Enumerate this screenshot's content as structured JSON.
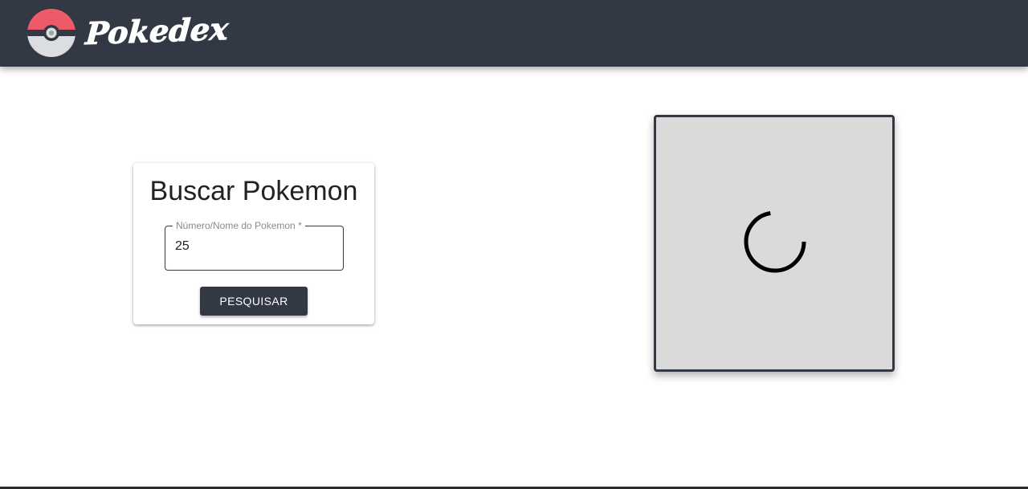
{
  "header": {
    "logo_text": "Pokedex",
    "logo_icon": "pokeball-icon",
    "background_color": "#323844"
  },
  "search_card": {
    "title": "Buscar Pokemon",
    "field_label": "Número/Nome do Pokemon *",
    "field_value": "25",
    "button_label": "PESQUISAR"
  },
  "result_panel": {
    "state": "loading",
    "spinner_icon": "loading-spinner-icon",
    "background_color": "#dadada"
  }
}
